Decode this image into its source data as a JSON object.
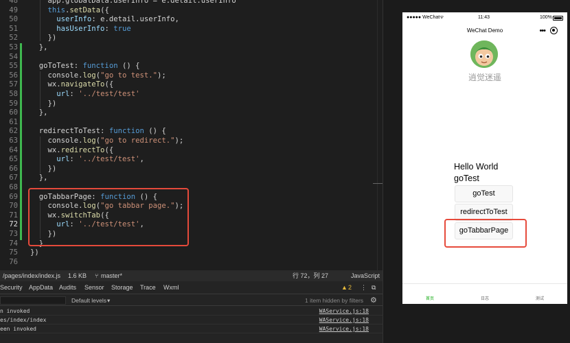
{
  "editor": {
    "lines": [
      {
        "n": "48",
        "code": "    app.globalData.userInfo = e.detail.userInfo"
      },
      {
        "n": "49",
        "code": "    this.setData({"
      },
      {
        "n": "50",
        "code": "      userInfo: e.detail.userInfo,"
      },
      {
        "n": "51",
        "code": "      hasUserInfo: true"
      },
      {
        "n": "52",
        "code": "    })"
      },
      {
        "n": "53",
        "code": "  },"
      },
      {
        "n": "54",
        "code": ""
      },
      {
        "n": "55",
        "code": "  goToTest: function () {"
      },
      {
        "n": "56",
        "code": "    console.log(\"go to test.\");"
      },
      {
        "n": "57",
        "code": "    wx.navigateTo({"
      },
      {
        "n": "58",
        "code": "      url: '../test/test'"
      },
      {
        "n": "59",
        "code": "    })"
      },
      {
        "n": "60",
        "code": "  },"
      },
      {
        "n": "61",
        "code": ""
      },
      {
        "n": "62",
        "code": "  redirectToTest: function () {"
      },
      {
        "n": "63",
        "code": "    console.log(\"go to redirect.\");"
      },
      {
        "n": "64",
        "code": "    wx.redirectTo({"
      },
      {
        "n": "65",
        "code": "      url: '../test/test',"
      },
      {
        "n": "66",
        "code": "    })"
      },
      {
        "n": "67",
        "code": "  },"
      },
      {
        "n": "68",
        "code": ""
      },
      {
        "n": "69",
        "code": "  goTabbarPage: function () {"
      },
      {
        "n": "70",
        "code": "    console.log(\"go tabbar page.\");"
      },
      {
        "n": "71",
        "code": "    wx.switchTab({"
      },
      {
        "n": "72",
        "code": "      url: '../test/test',"
      },
      {
        "n": "73",
        "code": "    })"
      },
      {
        "n": "74",
        "code": "  }"
      },
      {
        "n": "75",
        "code": "})"
      },
      {
        "n": "76",
        "code": ""
      }
    ],
    "current_line": "72"
  },
  "statusbar": {
    "path": "/pages/index/index.js",
    "size": "1.6 KB",
    "branch": "master*",
    "position": "行 72，列 27",
    "language": "JavaScript"
  },
  "devtools": {
    "tabs": [
      "Security",
      "AppData",
      "Audits",
      "Sensor",
      "Storage",
      "Trace",
      "Wxml"
    ],
    "warning_count": "2",
    "log_level": "Default levels",
    "hidden_info": "1 item hidden by filters",
    "logs": [
      {
        "msg": "n invoked",
        "src": "WAService.js:18"
      },
      {
        "msg": "es/index/index",
        "src": "WAService.js:18"
      },
      {
        "msg": "een invoked",
        "src": "WAService.js:18"
      }
    ]
  },
  "phone": {
    "carrier": "●●●●● WeChat",
    "time": "11:43",
    "battery": "100%",
    "nav_title": "WeChat Demo",
    "nickname": "逍觉迷遥",
    "hello": "Hello World",
    "go_test_text": "goTest",
    "buttons": [
      "goTest",
      "redirectToTest",
      "goTabbarPage"
    ],
    "tabs": [
      "首页",
      "日志",
      "测试"
    ]
  },
  "colors": {
    "accent_green": "#3fb950",
    "highlight_red": "#e64a3b",
    "tab_active": "#1aad19"
  }
}
